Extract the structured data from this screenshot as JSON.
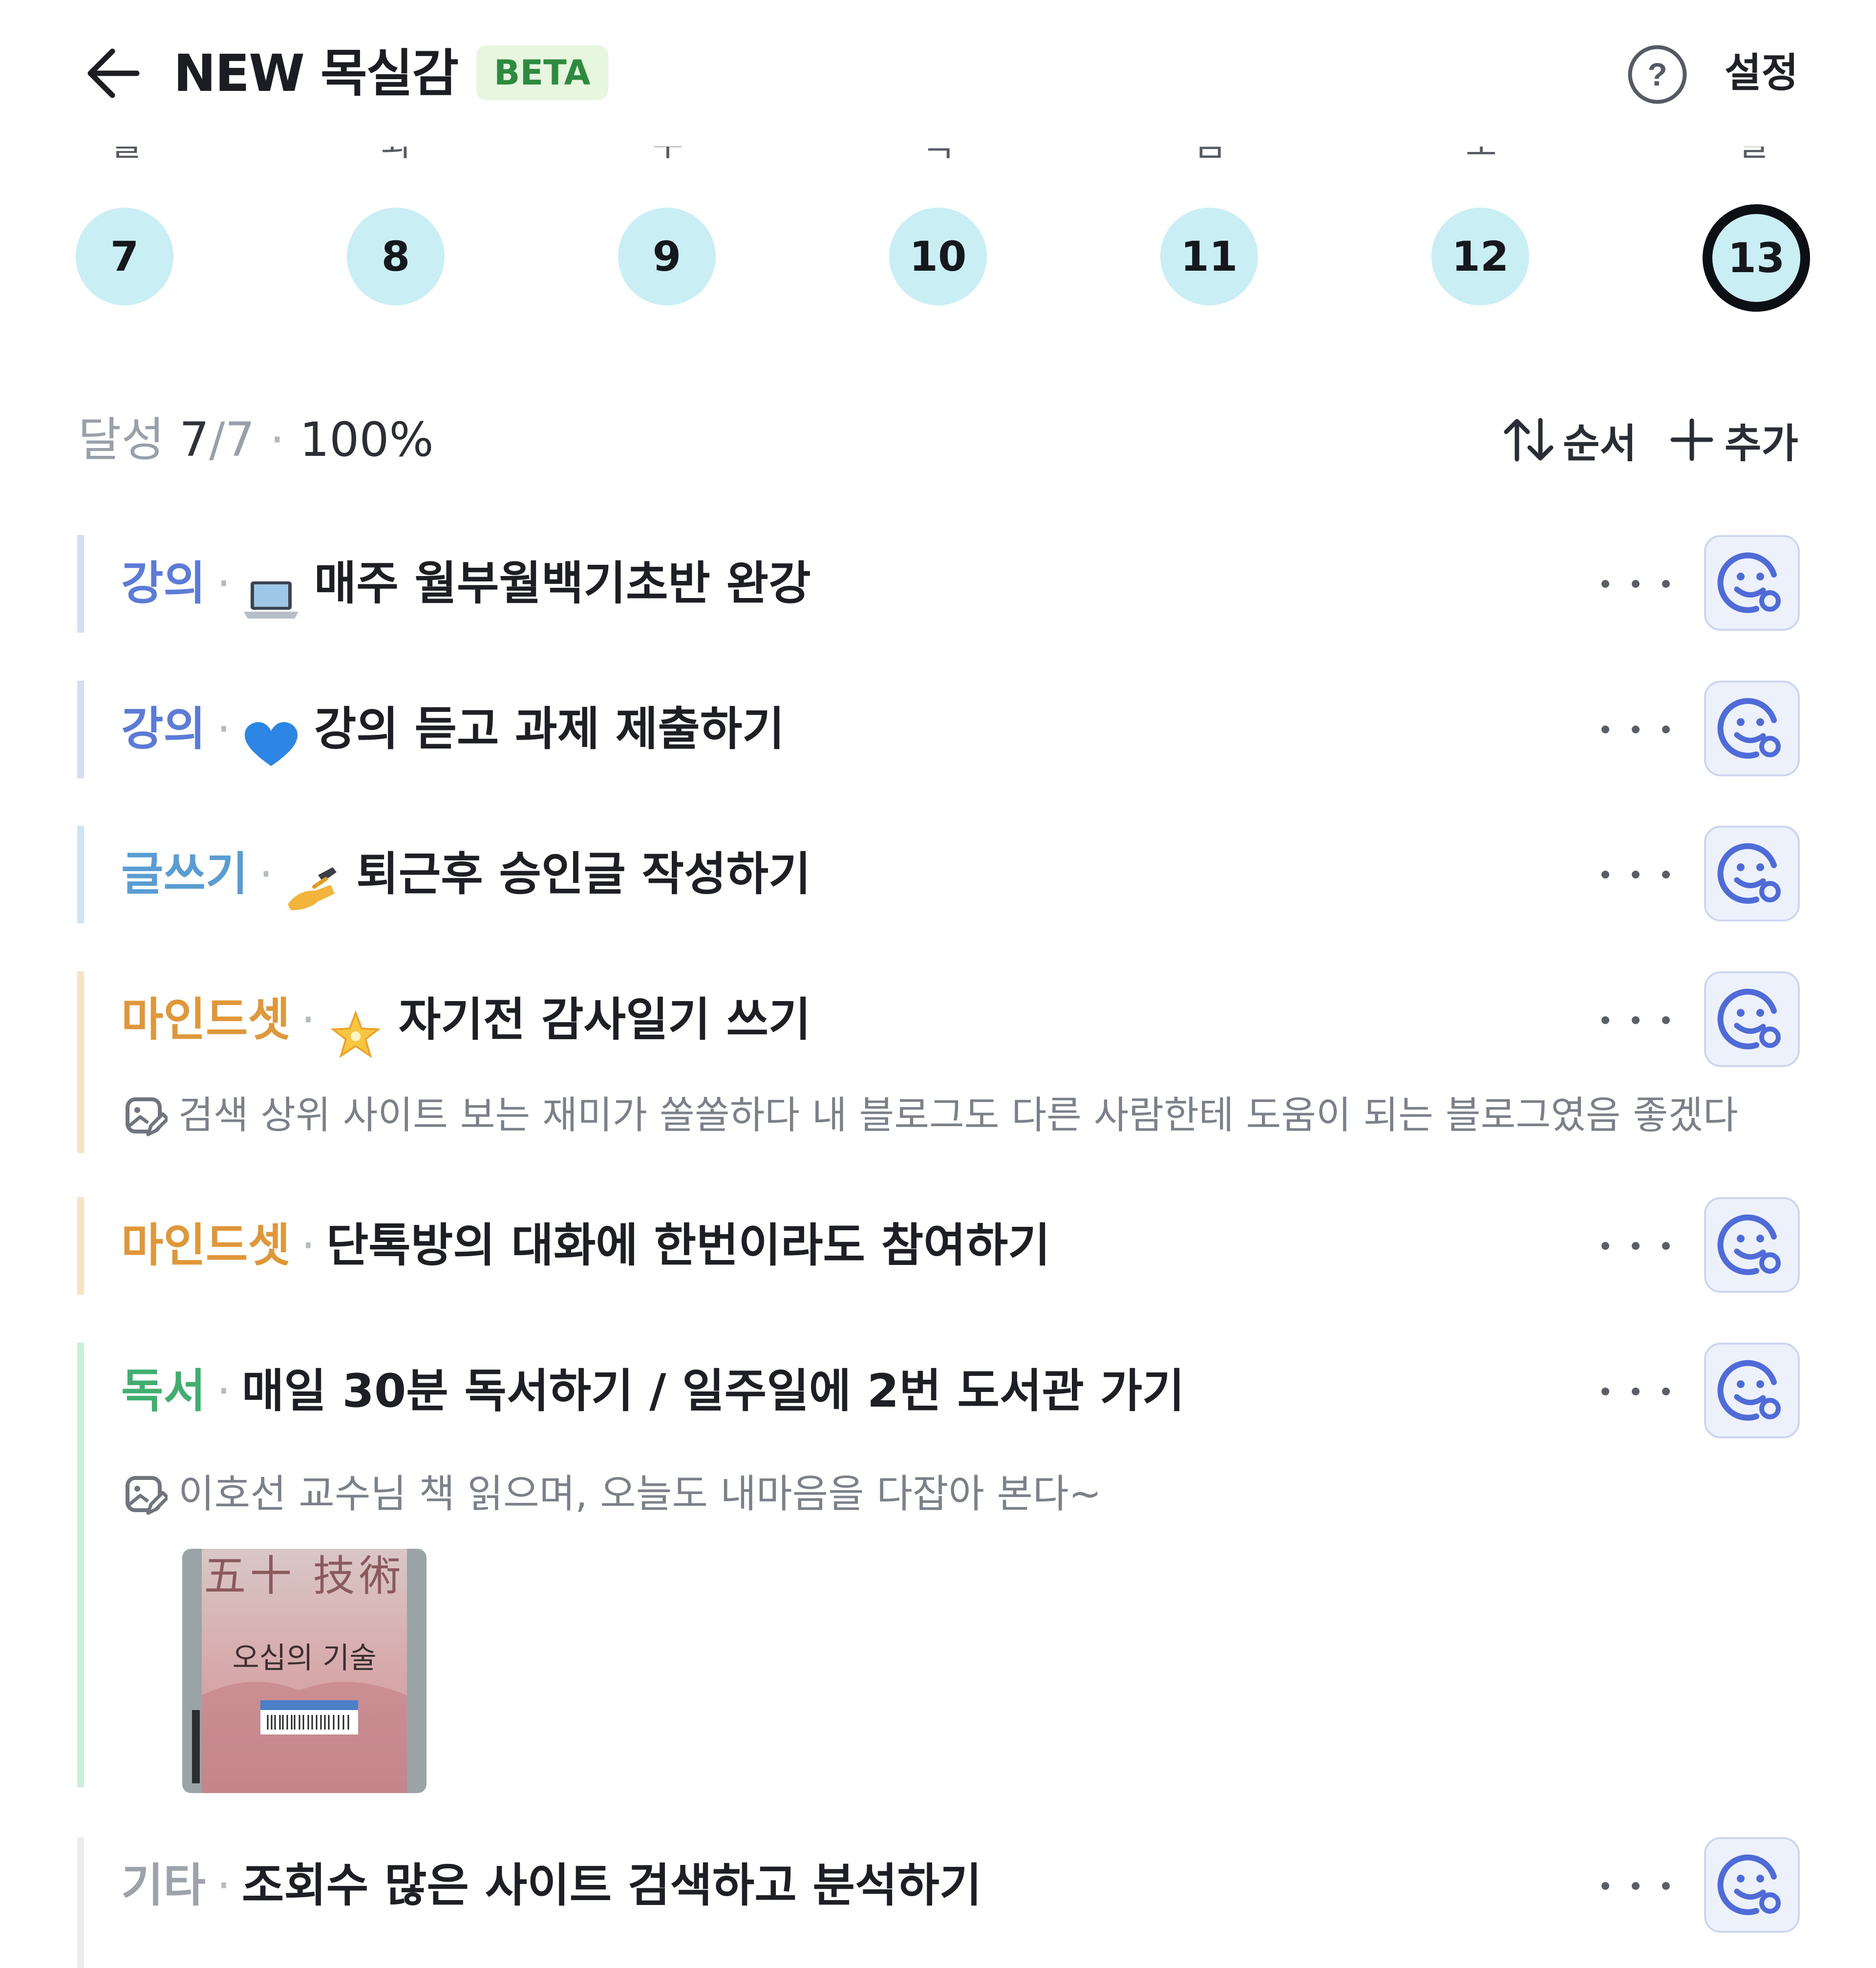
{
  "header": {
    "title": "NEW 목실감",
    "badge": "BETA",
    "settings_label": "설정"
  },
  "week": {
    "weekdays": [
      "월",
      "화",
      "수",
      "목",
      "금",
      "토",
      "일"
    ],
    "days": [
      "7",
      "8",
      "9",
      "10",
      "11",
      "12",
      "13"
    ],
    "selected_day": "13"
  },
  "summary": {
    "label": "달성",
    "done": "7",
    "total": "/7",
    "separator": "·",
    "percent": "100%",
    "sort_label": "순서",
    "add_label": "추가"
  },
  "goals": [
    {
      "category": "강의",
      "category_color": "#5b7bd6",
      "bar_color": "#d6ddf4",
      "emoji": "laptop-icon",
      "title": "매주 월부월백기초반 완강"
    },
    {
      "category": "강의",
      "category_color": "#5b7bd6",
      "bar_color": "#d6ddf4",
      "emoji": "blue-heart-icon",
      "title": "강의 듣고 과제 제출하기"
    },
    {
      "category": "글쓰기",
      "category_color": "#5a9dd2",
      "bar_color": "#cfe4f4",
      "emoji": "writing-hand-icon",
      "title": "퇴근후 승인글 작성하기"
    },
    {
      "category": "마인드셋",
      "category_color": "#e0973a",
      "bar_color": "#f8e2c2",
      "emoji": "glowing-star-icon",
      "title": "자기전 감사일기 쓰기",
      "memo": "검색 상위 사이트 보는 재미가 쏠쏠하다 내 블로그도 다른 사람한테 도움이 되는 블로그였음 좋겠다"
    },
    {
      "category": "마인드셋",
      "category_color": "#e0973a",
      "bar_color": "#f8e2c2",
      "title": "단톡방의 대화에 한번이라도 참여하기"
    },
    {
      "category": "독서",
      "category_color": "#3fae6f",
      "bar_color": "#c9efdb",
      "title": "매일 30분 독서하기 / 일주일에 2번 도서관 가기",
      "memo": "이호선 교수님 책 읽으며, 오늘도 내마음을 다잡아 본다~",
      "photo": {
        "cover_title_hanja": "五十 技術",
        "cover_title": "오십의 기술"
      }
    },
    {
      "category": "기타",
      "category_color": "#9ea3ab",
      "bar_color": "#ececef",
      "title": "조회수 많은 사이트 검색하고 분석하기"
    }
  ],
  "colors": {
    "accent_blue": "#4f6bd8",
    "day_circle": "#c9eef3",
    "beta_bg": "#e7f6df",
    "beta_text": "#2e8a3e"
  }
}
